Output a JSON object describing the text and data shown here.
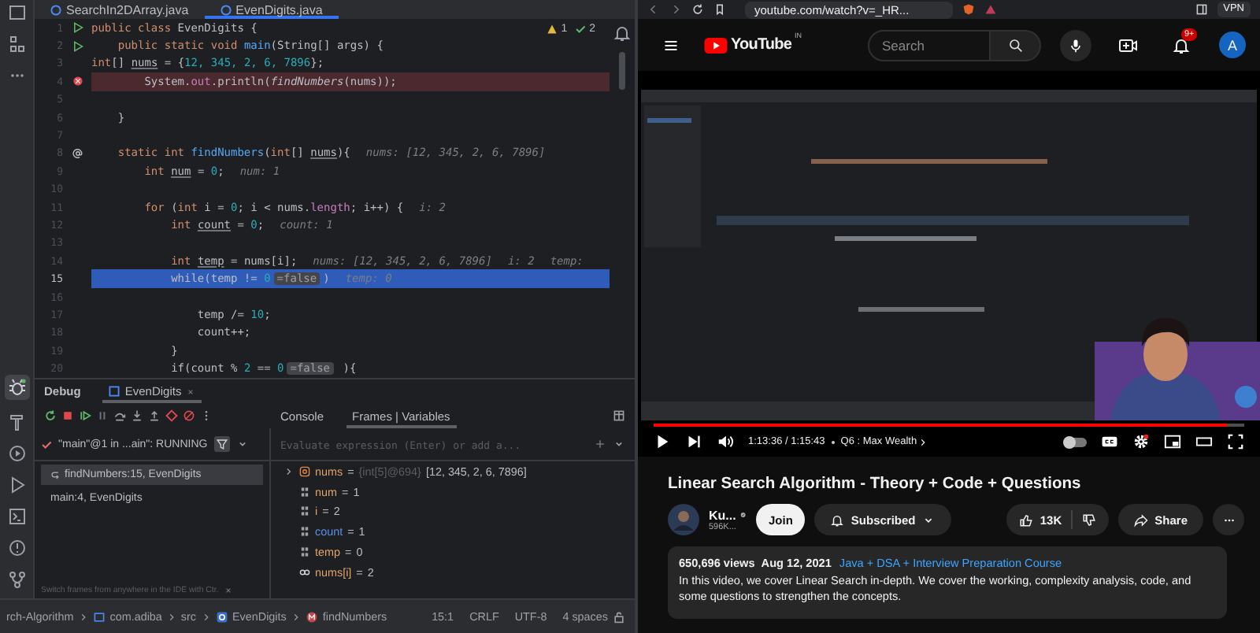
{
  "ide": {
    "editor_tabs": [
      {
        "label": "SearchIn2DArray.java",
        "selected": false
      },
      {
        "label": "EvenDigits.java",
        "selected": true
      }
    ],
    "inspections": {
      "warnings": "1",
      "checks": "2"
    },
    "lines": [
      {
        "number": "1",
        "kind": "normal",
        "run_marker": true,
        "parts": [
          {
            "kind": "code",
            "tokens": [
              {
                "text": "public class ",
                "kind": "kw"
              },
              {
                "text": "EvenDigits {",
                "kind": "text"
              }
            ]
          }
        ]
      },
      {
        "number": "2",
        "kind": "normal",
        "run_marker": true,
        "parts": [
          {
            "kind": "code",
            "tokens": [
              {
                "text": "    public static void ",
                "kind": "kw"
              },
              {
                "text": "main",
                "kind": "fn"
              },
              {
                "text": "(String[] args) {",
                "kind": "text"
              }
            ]
          }
        ]
      },
      {
        "number": "3",
        "kind": "normal",
        "parts": [
          {
            "kind": "code",
            "tokens": [
              {
                "text": "int",
                "kind": "kw"
              },
              {
                "text": "[] ",
                "kind": "text"
              },
              {
                "text": "nums",
                "kind": "var"
              },
              {
                "text": " = {",
                "kind": "text"
              },
              {
                "text": "12, 345, 2, 6, 7896",
                "kind": "num"
              },
              {
                "text": "};",
                "kind": "text"
              }
            ]
          }
        ]
      },
      {
        "number": "4",
        "kind": "breakpoint",
        "parts": [
          {
            "kind": "code",
            "tokens": [
              {
                "text": "        System.",
                "kind": "text"
              },
              {
                "text": "out",
                "kind": "field"
              },
              {
                "text": ".println(",
                "kind": "text"
              },
              {
                "text": "findNumbers",
                "kind": "call"
              },
              {
                "text": "(nums));",
                "kind": "text"
              }
            ]
          }
        ]
      },
      {
        "number": "5",
        "kind": "normal"
      },
      {
        "number": "6",
        "kind": "normal",
        "parts": [
          {
            "kind": "code",
            "tokens": [
              {
                "text": "    }",
                "kind": "text"
              }
            ]
          }
        ]
      },
      {
        "number": "7",
        "kind": "normal"
      },
      {
        "number": "8",
        "kind": "normal",
        "override_marker": true,
        "parts": [
          {
            "kind": "code",
            "tokens": [
              {
                "text": "    static int ",
                "kind": "kw"
              },
              {
                "text": "findNumbers",
                "kind": "fn"
              },
              {
                "text": "(",
                "kind": "text"
              },
              {
                "text": "int",
                "kind": "kw"
              },
              {
                "text": "[] ",
                "kind": "text"
              },
              {
                "text": "nums",
                "kind": "var"
              },
              {
                "text": "){",
                "kind": "text"
              }
            ]
          },
          {
            "kind": "hint",
            "text": "nums: [12, 345, 2, 6, 7896]"
          }
        ]
      },
      {
        "number": "9",
        "kind": "normal",
        "parts": [
          {
            "kind": "code",
            "tokens": [
              {
                "text": "        int ",
                "kind": "kw"
              },
              {
                "text": "num",
                "kind": "var"
              },
              {
                "text": " = ",
                "kind": "text"
              },
              {
                "text": "0",
                "kind": "num"
              },
              {
                "text": ";",
                "kind": "text"
              }
            ]
          },
          {
            "kind": "hint",
            "text": "num: 1"
          }
        ]
      },
      {
        "number": "10",
        "kind": "normal"
      },
      {
        "number": "11",
        "kind": "normal",
        "parts": [
          {
            "kind": "code",
            "tokens": [
              {
                "text": "        for ",
                "kind": "kw"
              },
              {
                "text": "(",
                "kind": "text"
              },
              {
                "text": "int ",
                "kind": "kw"
              },
              {
                "text": "i = ",
                "kind": "text"
              },
              {
                "text": "0",
                "kind": "num"
              },
              {
                "text": "; i < nums.",
                "kind": "text"
              },
              {
                "text": "length",
                "kind": "field"
              },
              {
                "text": "; i++) {",
                "kind": "text"
              }
            ]
          },
          {
            "kind": "hint",
            "text": "i: 2"
          }
        ]
      },
      {
        "number": "12",
        "kind": "normal",
        "parts": [
          {
            "kind": "code",
            "tokens": [
              {
                "text": "            int ",
                "kind": "kw"
              },
              {
                "text": "count",
                "kind": "var"
              },
              {
                "text": " = ",
                "kind": "text"
              },
              {
                "text": "0",
                "kind": "num"
              },
              {
                "text": ";",
                "kind": "text"
              }
            ]
          },
          {
            "kind": "hint",
            "text": "count: 1"
          }
        ]
      },
      {
        "number": "13",
        "kind": "normal"
      },
      {
        "number": "14",
        "kind": "normal",
        "parts": [
          {
            "kind": "code",
            "tokens": [
              {
                "text": "            int ",
                "kind": "kw"
              },
              {
                "text": "temp",
                "kind": "var"
              },
              {
                "text": " = nums[i];",
                "kind": "text"
              }
            ]
          },
          {
            "kind": "hint",
            "text": "nums: [12, 345, 2, 6, 7896]"
          },
          {
            "kind": "hint",
            "text": "i: 2"
          },
          {
            "kind": "hint",
            "text": "temp:"
          }
        ]
      },
      {
        "number": "15",
        "kind": "current",
        "parts": [
          {
            "kind": "code",
            "tokens": [
              {
                "text": "            while(temp != ",
                "kind": "text"
              },
              {
                "text": "0",
                "kind": "num"
              }
            ]
          },
          {
            "kind": "badge",
            "text": "=false"
          },
          {
            "kind": "code",
            "tokens": [
              {
                "text": ")",
                "kind": "text"
              }
            ]
          },
          {
            "kind": "hint",
            "text": "temp: 0"
          }
        ]
      },
      {
        "number": "16",
        "kind": "normal"
      },
      {
        "number": "17",
        "kind": "normal",
        "parts": [
          {
            "kind": "code",
            "tokens": [
              {
                "text": "                temp",
                "kind": "text"
              },
              {
                "text": " /= ",
                "kind": "text"
              },
              {
                "text": "10",
                "kind": "num"
              },
              {
                "text": ";",
                "kind": "text"
              }
            ]
          }
        ]
      },
      {
        "number": "18",
        "kind": "normal",
        "parts": [
          {
            "kind": "code",
            "tokens": [
              {
                "text": "                count++;",
                "kind": "text"
              }
            ]
          }
        ]
      },
      {
        "number": "19",
        "kind": "normal",
        "parts": [
          {
            "kind": "code",
            "tokens": [
              {
                "text": "            }",
                "kind": "text"
              }
            ]
          }
        ]
      },
      {
        "number": "20",
        "kind": "normal",
        "parts": [
          {
            "kind": "code",
            "tokens": [
              {
                "text": "            if(count % ",
                "kind": "text"
              },
              {
                "text": "2",
                "kind": "num"
              },
              {
                "text": " == ",
                "kind": "text"
              },
              {
                "text": "0",
                "kind": "num"
              }
            ]
          },
          {
            "kind": "badge",
            "text": "=false"
          },
          {
            "kind": "code",
            "tokens": [
              {
                "text": " ){",
                "kind": "text"
              }
            ]
          }
        ]
      }
    ],
    "debug": {
      "title": "Debug",
      "session_tab": "EvenDigits",
      "view_tabs": [
        {
          "label": "Console",
          "selected": false
        },
        {
          "label": "Frames | Variables",
          "selected": true
        }
      ],
      "thread": "\"main\"@1 in ...ain\": RUNNING",
      "evaluate_placeholder": "Evaluate expression (Enter) or add a...",
      "frames": [
        {
          "label": "findNumbers:15, EvenDigits",
          "selected": true
        },
        {
          "label": "main:4, EvenDigits",
          "selected": false
        }
      ],
      "variables": [
        {
          "kind": "array",
          "name": "nums",
          "op": "=",
          "type": "{int[5]@694}",
          "value": "[12, 345, 2, 6, 7896]",
          "changed": false
        },
        {
          "kind": "primitive",
          "name": "num",
          "op": "=",
          "value": "1",
          "changed": false
        },
        {
          "kind": "primitive",
          "name": "i",
          "op": "=",
          "value": "2",
          "changed": false
        },
        {
          "kind": "primitive",
          "name": "count",
          "op": "=",
          "value": "1",
          "changed": true
        },
        {
          "kind": "primitive",
          "name": "temp",
          "op": "=",
          "value": "0",
          "changed": false
        },
        {
          "kind": "watch",
          "name": "nums[i]",
          "op": "=",
          "value": "2",
          "changed": false
        }
      ],
      "hint": "Switch frames from anywhere in the IDE with Ctr."
    },
    "status_bar": {
      "breadcrumbs": [
        {
          "kind": "project",
          "label": "rch-Algorithm"
        },
        {
          "kind": "package",
          "label": "com.adiba"
        },
        {
          "kind": "folder",
          "label": "src"
        },
        {
          "kind": "class",
          "label": "EvenDigits"
        },
        {
          "kind": "method",
          "label": "findNumbers"
        }
      ],
      "position": "15:1",
      "line_ending": "CRLF",
      "encoding": "UTF-8",
      "indent": "4 spaces"
    }
  },
  "browser": {
    "url": "youtube.com/watch?v=_HR...",
    "vpn": "VPN"
  },
  "youtube": {
    "logo": "YouTube",
    "region": "IN",
    "search_placeholder": "Search",
    "notifications": "9+",
    "avatar": "A",
    "video": {
      "level": 0.97,
      "time": "1:13:36 / 1:15:43",
      "chapter": "Q6 : Max Wealth",
      "autoplay": false
    },
    "title": "Linear Search Algorithm - Theory + Code + Questions",
    "channel": {
      "name": "Ku...",
      "subscribers": "596K..."
    },
    "join": "Join",
    "subscribe": {
      "label": "Subscribed",
      "subscribed": true
    },
    "likes": "13K",
    "share": "Share",
    "description": {
      "views": "650,696 views",
      "date": "Aug 12, 2021",
      "link": "Java + DSA + Interview Preparation Course",
      "text": "In this video, we cover Linear Search in-depth. We cover the working, complexity analysis, code, and some questions to strengthen the concepts."
    }
  }
}
